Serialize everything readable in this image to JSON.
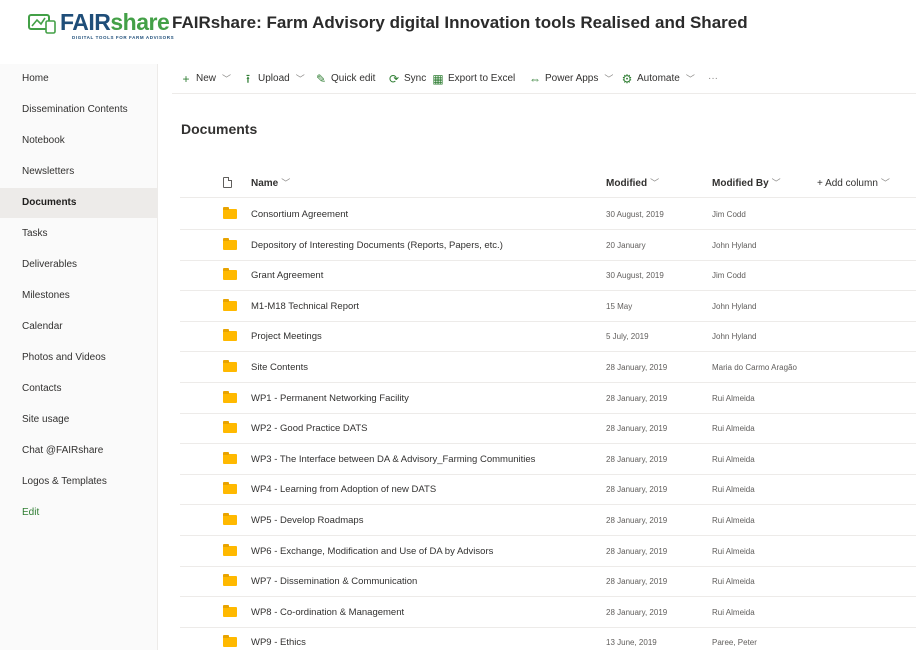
{
  "header": {
    "logo_fair": "FAIR",
    "logo_share": "share",
    "logo_tagline": "DIGITAL TOOLS FOR FARM ADVISORS",
    "site_title": "FAIRshare: Farm Advisory digital Innovation tools Realised and Shared"
  },
  "sidebar": {
    "items": [
      {
        "label": "Home"
      },
      {
        "label": "Dissemination Contents"
      },
      {
        "label": "Notebook"
      },
      {
        "label": "Newsletters"
      },
      {
        "label": "Documents"
      },
      {
        "label": "Tasks"
      },
      {
        "label": "Deliverables"
      },
      {
        "label": "Milestones"
      },
      {
        "label": "Calendar"
      },
      {
        "label": "Photos and Videos"
      },
      {
        "label": "Contacts"
      },
      {
        "label": "Site usage"
      },
      {
        "label": "Chat @FAIRshare"
      },
      {
        "label": "Logos & Templates"
      },
      {
        "label": "Edit"
      }
    ],
    "selected": "Documents"
  },
  "commandbar": {
    "new": "New",
    "upload": "Upload",
    "quick_edit": "Quick edit",
    "sync": "Sync",
    "export": "Export to Excel",
    "power_apps": "Power Apps",
    "automate": "Automate",
    "more": "···"
  },
  "main": {
    "heading": "Documents",
    "columns": {
      "name": "Name",
      "modified": "Modified",
      "modified_by": "Modified By",
      "add_column": "+ Add column"
    },
    "rows": [
      {
        "name": "Consortium Agreement",
        "modified": "30 August, 2019",
        "modified_by": "Jim Codd"
      },
      {
        "name": "Depository of Interesting Documents (Reports, Papers, etc.)",
        "modified": "20 January",
        "modified_by": "John Hyland"
      },
      {
        "name": "Grant Agreement",
        "modified": "30 August, 2019",
        "modified_by": "Jim Codd"
      },
      {
        "name": "M1-M18 Technical Report",
        "modified": "15 May",
        "modified_by": "John Hyland"
      },
      {
        "name": "Project Meetings",
        "modified": "5 July, 2019",
        "modified_by": "John Hyland"
      },
      {
        "name": "Site Contents",
        "modified": "28 January, 2019",
        "modified_by": "Maria do Carmo Aragão"
      },
      {
        "name": "WP1 - Permanent Networking Facility",
        "modified": "28 January, 2019",
        "modified_by": "Rui Almeida"
      },
      {
        "name": "WP2 - Good Practice DATS",
        "modified": "28 January, 2019",
        "modified_by": "Rui Almeida"
      },
      {
        "name": "WP3 - The Interface between DA & Advisory_Farming Communities",
        "modified": "28 January, 2019",
        "modified_by": "Rui Almeida"
      },
      {
        "name": "WP4 - Learning from Adoption of new DATS",
        "modified": "28 January, 2019",
        "modified_by": "Rui Almeida"
      },
      {
        "name": "WP5 - Develop Roadmaps",
        "modified": "28 January, 2019",
        "modified_by": "Rui Almeida"
      },
      {
        "name": "WP6 - Exchange, Modification and Use of DA by Advisors",
        "modified": "28 January, 2019",
        "modified_by": "Rui Almeida"
      },
      {
        "name": "WP7 - Dissemination & Communication",
        "modified": "28 January, 2019",
        "modified_by": "Rui Almeida"
      },
      {
        "name": "WP8 - Co-ordination & Management",
        "modified": "28 January, 2019",
        "modified_by": "Rui Almeida"
      },
      {
        "name": "WP9 - Ethics",
        "modified": "13 June, 2019",
        "modified_by": "Paree, Peter"
      }
    ]
  },
  "colors": {
    "accent": "#2e7d32",
    "folder": "#ffb900",
    "logo_blue": "#1f4e79",
    "logo_green": "#43a047"
  }
}
